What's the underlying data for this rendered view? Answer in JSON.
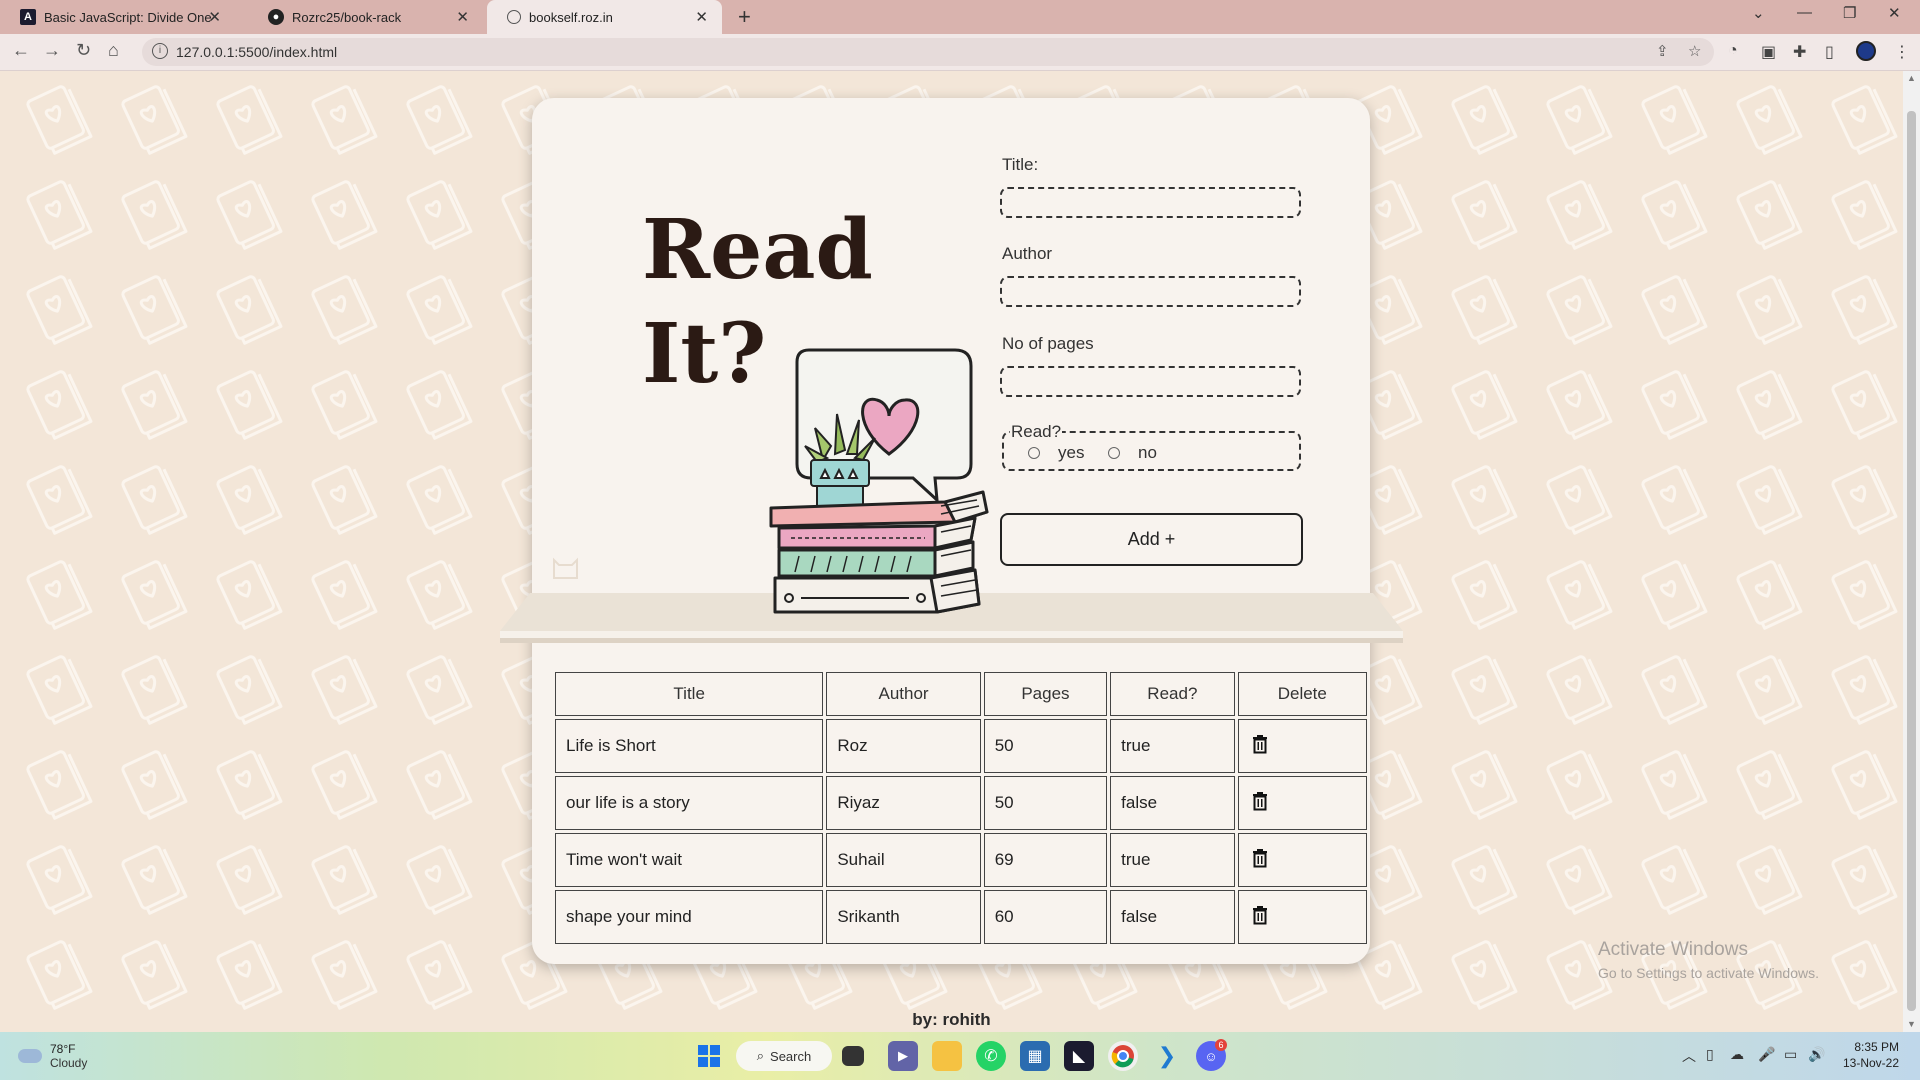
{
  "browser": {
    "tabs": [
      {
        "title": "Basic JavaScript: Divide One Num",
        "icon": "js-icon"
      },
      {
        "title": "Rozrc25/book-rack",
        "icon": "github-icon"
      },
      {
        "title": "bookself.roz.in",
        "icon": "globe-icon"
      }
    ],
    "active_tab": 2,
    "url": "127.0.0.1:5500/index.html",
    "new_tab": "+"
  },
  "page": {
    "headline_line1": "Read",
    "headline_line2": "It?",
    "form": {
      "title_label": "Title:",
      "author_label": "Author",
      "pages_label": "No of pages",
      "read_legend": "Read?",
      "yes_label": "yes",
      "no_label": "no",
      "add_button": "Add +"
    },
    "table": {
      "headers": [
        "Title",
        "Author",
        "Pages",
        "Read?",
        "Delete"
      ],
      "rows": [
        {
          "title": "Life is Short",
          "author": "Roz",
          "pages": "50",
          "read": "true"
        },
        {
          "title": "our life is a story",
          "author": "Riyaz",
          "pages": "50",
          "read": "false"
        },
        {
          "title": "Time won't wait",
          "author": "Suhail",
          "pages": "69",
          "read": "true"
        },
        {
          "title": "shape your mind",
          "author": "Srikanth",
          "pages": "60",
          "read": "false"
        }
      ]
    },
    "footer": "by: rohith",
    "watermark_line1": "Activate Windows",
    "watermark_line2": "Go to Settings to activate Windows."
  },
  "taskbar": {
    "temperature": "78°F",
    "condition": "Cloudy",
    "search_label": "Search",
    "time": "8:35 PM",
    "date": "13-Nov-22",
    "discord_badge": "6"
  },
  "colors": {
    "page_bg": "#f3e6d8",
    "card_bg": "#f8f3ee",
    "headline": "#2b1a14",
    "tabbar": "#d9b3ae"
  }
}
